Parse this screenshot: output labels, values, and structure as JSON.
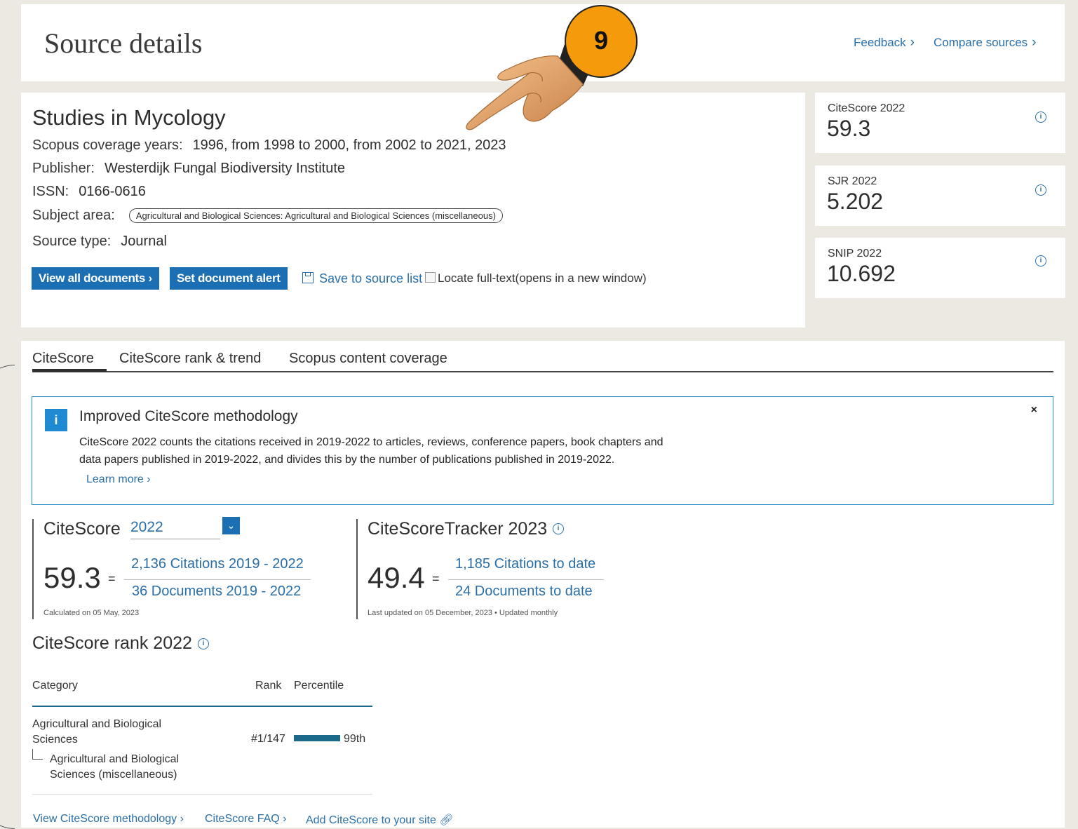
{
  "header": {
    "title": "Source details",
    "feedback_label": "Feedback",
    "compare_label": "Compare sources"
  },
  "source": {
    "name": "Studies in Mycology",
    "coverage_label": "Scopus coverage years:",
    "coverage_value": "1996, from 1998 to 2000, from 2002 to 2021, 2023",
    "publisher_label": "Publisher:",
    "publisher_value": "Westerdijk Fungal Biodiversity Institute",
    "issn_label": "ISSN:",
    "issn_value": "0166-0616",
    "subject_label": "Subject area:",
    "subject_value": "Agricultural and Biological Sciences: Agricultural and Biological Sciences (miscellaneous)",
    "type_label": "Source type:",
    "type_value": "Journal"
  },
  "actions": {
    "view_all": "View all documents",
    "set_alert": "Set document alert",
    "save": "Save to source list",
    "locate": "Locate full-text(opens in a new window)"
  },
  "metrics": [
    {
      "label": "CiteScore 2022",
      "value": "59.3"
    },
    {
      "label": "SJR 2022",
      "value": "5.202"
    },
    {
      "label": "SNIP 2022",
      "value": "10.692"
    }
  ],
  "tabs": [
    {
      "label": "CiteScore"
    },
    {
      "label": "CiteScore rank & trend"
    },
    {
      "label": "Scopus content coverage"
    }
  ],
  "notice": {
    "icon": "i",
    "title": "Improved CiteScore methodology",
    "body": "CiteScore 2022 counts the citations received in 2019-2022 to articles, reviews, conference papers, book chapters and data papers published in 2019-2022, and divides this by the number of publications published in 2019-2022.",
    "learn_more": "Learn more",
    "close": "×"
  },
  "citescore": {
    "heading": "CiteScore",
    "year": "2022",
    "value": "59.3",
    "eq": "=",
    "citations": "2,136 Citations 2019 - 2022",
    "documents": "36 Documents 2019 - 2022",
    "calc_note": "Calculated on 05 May, 2023"
  },
  "tracker": {
    "heading": "CiteScoreTracker 2023",
    "value": "49.4",
    "eq": "=",
    "citations": "1,185 Citations to date",
    "documents": "24 Documents to date",
    "update_note": "Last updated on 05 December, 2023 • Updated monthly"
  },
  "rank": {
    "heading": "CiteScore rank 2022",
    "col_category": "Category",
    "col_rank": "Rank",
    "col_percentile": "Percentile",
    "row_category_1": "Agricultural and Biological",
    "row_category_2": "Sciences",
    "row_sub_1": "Agricultural and Biological",
    "row_sub_2": "Sciences (miscellaneous)",
    "row_rank": "#1/147",
    "row_percentile": "99th",
    "row_percentile_value": 99
  },
  "footer": {
    "methodology": "View CiteScore methodology",
    "faq": "CiteScore FAQ",
    "add": "Add CiteScore to your site"
  },
  "annotation": {
    "badge": "9"
  },
  "colors": {
    "link": "#2a6fa8",
    "button": "#1d6fb4",
    "notice_border": "#2a8cc4",
    "rank_bar": "#1b6a8c",
    "badge": "#f59a0b"
  }
}
